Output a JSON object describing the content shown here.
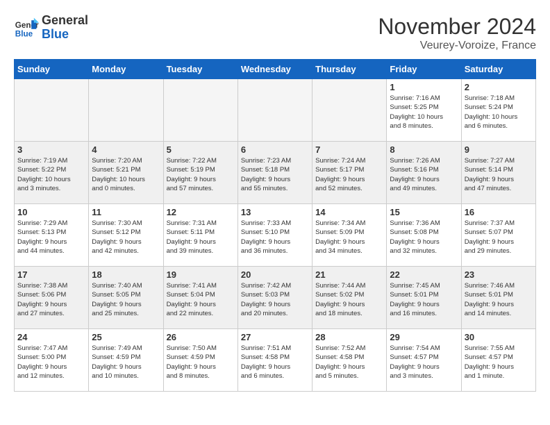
{
  "header": {
    "logo_line1": "General",
    "logo_line2": "Blue",
    "month": "November 2024",
    "location": "Veurey-Voroize, France"
  },
  "weekdays": [
    "Sunday",
    "Monday",
    "Tuesday",
    "Wednesday",
    "Thursday",
    "Friday",
    "Saturday"
  ],
  "weeks": [
    [
      {
        "day": "",
        "info": ""
      },
      {
        "day": "",
        "info": ""
      },
      {
        "day": "",
        "info": ""
      },
      {
        "day": "",
        "info": ""
      },
      {
        "day": "",
        "info": ""
      },
      {
        "day": "1",
        "info": "Sunrise: 7:16 AM\nSunset: 5:25 PM\nDaylight: 10 hours\nand 8 minutes."
      },
      {
        "day": "2",
        "info": "Sunrise: 7:18 AM\nSunset: 5:24 PM\nDaylight: 10 hours\nand 6 minutes."
      }
    ],
    [
      {
        "day": "3",
        "info": "Sunrise: 7:19 AM\nSunset: 5:22 PM\nDaylight: 10 hours\nand 3 minutes."
      },
      {
        "day": "4",
        "info": "Sunrise: 7:20 AM\nSunset: 5:21 PM\nDaylight: 10 hours\nand 0 minutes."
      },
      {
        "day": "5",
        "info": "Sunrise: 7:22 AM\nSunset: 5:19 PM\nDaylight: 9 hours\nand 57 minutes."
      },
      {
        "day": "6",
        "info": "Sunrise: 7:23 AM\nSunset: 5:18 PM\nDaylight: 9 hours\nand 55 minutes."
      },
      {
        "day": "7",
        "info": "Sunrise: 7:24 AM\nSunset: 5:17 PM\nDaylight: 9 hours\nand 52 minutes."
      },
      {
        "day": "8",
        "info": "Sunrise: 7:26 AM\nSunset: 5:16 PM\nDaylight: 9 hours\nand 49 minutes."
      },
      {
        "day": "9",
        "info": "Sunrise: 7:27 AM\nSunset: 5:14 PM\nDaylight: 9 hours\nand 47 minutes."
      }
    ],
    [
      {
        "day": "10",
        "info": "Sunrise: 7:29 AM\nSunset: 5:13 PM\nDaylight: 9 hours\nand 44 minutes."
      },
      {
        "day": "11",
        "info": "Sunrise: 7:30 AM\nSunset: 5:12 PM\nDaylight: 9 hours\nand 42 minutes."
      },
      {
        "day": "12",
        "info": "Sunrise: 7:31 AM\nSunset: 5:11 PM\nDaylight: 9 hours\nand 39 minutes."
      },
      {
        "day": "13",
        "info": "Sunrise: 7:33 AM\nSunset: 5:10 PM\nDaylight: 9 hours\nand 36 minutes."
      },
      {
        "day": "14",
        "info": "Sunrise: 7:34 AM\nSunset: 5:09 PM\nDaylight: 9 hours\nand 34 minutes."
      },
      {
        "day": "15",
        "info": "Sunrise: 7:36 AM\nSunset: 5:08 PM\nDaylight: 9 hours\nand 32 minutes."
      },
      {
        "day": "16",
        "info": "Sunrise: 7:37 AM\nSunset: 5:07 PM\nDaylight: 9 hours\nand 29 minutes."
      }
    ],
    [
      {
        "day": "17",
        "info": "Sunrise: 7:38 AM\nSunset: 5:06 PM\nDaylight: 9 hours\nand 27 minutes."
      },
      {
        "day": "18",
        "info": "Sunrise: 7:40 AM\nSunset: 5:05 PM\nDaylight: 9 hours\nand 25 minutes."
      },
      {
        "day": "19",
        "info": "Sunrise: 7:41 AM\nSunset: 5:04 PM\nDaylight: 9 hours\nand 22 minutes."
      },
      {
        "day": "20",
        "info": "Sunrise: 7:42 AM\nSunset: 5:03 PM\nDaylight: 9 hours\nand 20 minutes."
      },
      {
        "day": "21",
        "info": "Sunrise: 7:44 AM\nSunset: 5:02 PM\nDaylight: 9 hours\nand 18 minutes."
      },
      {
        "day": "22",
        "info": "Sunrise: 7:45 AM\nSunset: 5:01 PM\nDaylight: 9 hours\nand 16 minutes."
      },
      {
        "day": "23",
        "info": "Sunrise: 7:46 AM\nSunset: 5:01 PM\nDaylight: 9 hours\nand 14 minutes."
      }
    ],
    [
      {
        "day": "24",
        "info": "Sunrise: 7:47 AM\nSunset: 5:00 PM\nDaylight: 9 hours\nand 12 minutes."
      },
      {
        "day": "25",
        "info": "Sunrise: 7:49 AM\nSunset: 4:59 PM\nDaylight: 9 hours\nand 10 minutes."
      },
      {
        "day": "26",
        "info": "Sunrise: 7:50 AM\nSunset: 4:59 PM\nDaylight: 9 hours\nand 8 minutes."
      },
      {
        "day": "27",
        "info": "Sunrise: 7:51 AM\nSunset: 4:58 PM\nDaylight: 9 hours\nand 6 minutes."
      },
      {
        "day": "28",
        "info": "Sunrise: 7:52 AM\nSunset: 4:58 PM\nDaylight: 9 hours\nand 5 minutes."
      },
      {
        "day": "29",
        "info": "Sunrise: 7:54 AM\nSunset: 4:57 PM\nDaylight: 9 hours\nand 3 minutes."
      },
      {
        "day": "30",
        "info": "Sunrise: 7:55 AM\nSunset: 4:57 PM\nDaylight: 9 hours\nand 1 minute."
      }
    ]
  ]
}
